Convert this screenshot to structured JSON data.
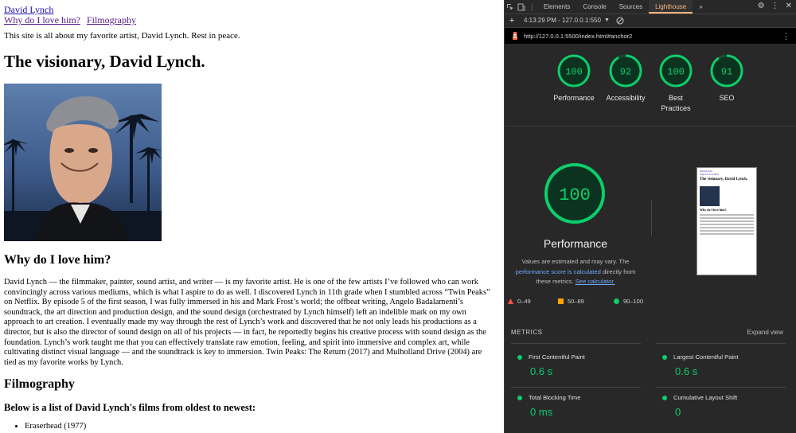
{
  "page": {
    "nav_home": "David Lynch",
    "nav_why": "Why do I love him?",
    "nav_film": "Filmography",
    "intro": "This site is all about my favorite artist, David Lynch. Rest in peace.",
    "heading": "The visionary, David Lynch.",
    "why_heading": "Why do I love him?",
    "bio": "David Lynch — the filmmaker, painter, sound artist, and writer — is my favorite artist. He is one of the few artists I’ve followed who can work convincingly across various mediums, which is what I aspire to do as well. I discovered Lynch in 11th grade when I stumbled across “Twin Peaks” on Netflix. By episode 5 of the first season, I was fully immersed in his and Mark Frost’s world; the offbeat writing, Angelo Badalamenti’s soundtrack, the art direction and production design, and the sound design (orchestrated by Lynch himself) left an indelible mark on my own approach to art creation. I eventually made my way through the rest of Lynch’s work and discovered that he not only leads his productions as a director, but is also the director of sound design on all of his projects — in fact, he reportedly begins his creative process with sound design as the foundation. Lynch’s work taught me that you can effectively translate raw emotion, feeling, and spirit into immersive and complex art, while cultivating distinct visual language — and the soundtrack is key to immersion. Twin Peaks: The Return (2017) and Mulholland Drive (2004) are tied as my favorite works by Lynch.",
    "film_heading": "Filmography",
    "film_sub": "Below is a list of David Lynch's films from oldest to newest:",
    "films": [
      "Eraserhead (1977)"
    ]
  },
  "devtools": {
    "tabs": [
      "Elements",
      "Console",
      "Sources",
      "Lighthouse"
    ],
    "more_tabs": "»",
    "report_time": "4:13:29 PM - 127.0.0.1:550",
    "url": "http://127.0.0.1:5500/index.html#anchor2",
    "scores": [
      {
        "label": "Performance",
        "value": "100",
        "score": 100
      },
      {
        "label": "Accessibility",
        "value": "92",
        "score": 92
      },
      {
        "label": "Best Practices",
        "value": "100",
        "score": 100
      },
      {
        "label": "SEO",
        "value": "91",
        "score": 91
      }
    ],
    "main_score": {
      "label": "Performance",
      "value": "100",
      "score": 100
    },
    "note_1": "Values are estimated and may vary. The",
    "note_link": "performance score is calculated",
    "note_2": "directly from",
    "note_3": "these metrics.",
    "note_calc": "See calculator.",
    "legend": [
      "0–49",
      "50–89",
      "90–100"
    ],
    "metrics_title": "METRICS",
    "expand_label": "Expand view",
    "metrics": [
      {
        "name": "First Contentful Paint",
        "value": "0.6 s"
      },
      {
        "name": "Largest Contentful Paint",
        "value": "0.6 s"
      },
      {
        "name": "Total Blocking Time",
        "value": "0 ms"
      },
      {
        "name": "Cumulative Layout Shift",
        "value": "0"
      }
    ],
    "colors": {
      "pass": "#0cce6b",
      "average": "#ffa400",
      "fail": "#ff4e42",
      "accent": "#ffb57a"
    }
  }
}
